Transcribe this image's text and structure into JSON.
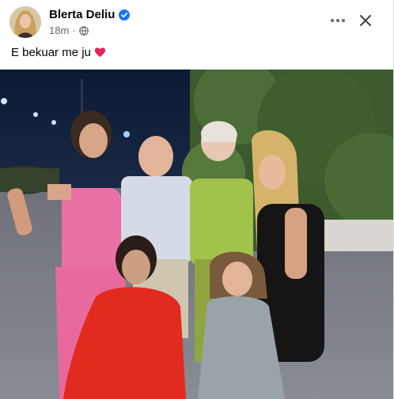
{
  "post": {
    "author": "Blerta Deliu",
    "timestamp": "18m",
    "separator": "·",
    "audience_icon": "globe-icon",
    "verified_icon": "verified-badge-icon",
    "caption": "E bekuar me ju",
    "caption_emoji": "heart-emoji",
    "actions": {
      "more_icon": "more-options-icon",
      "close_icon": "close-icon"
    },
    "colors": {
      "verified": "#1877f2",
      "heart": "#e0245e",
      "meta_text": "#65676b"
    }
  }
}
